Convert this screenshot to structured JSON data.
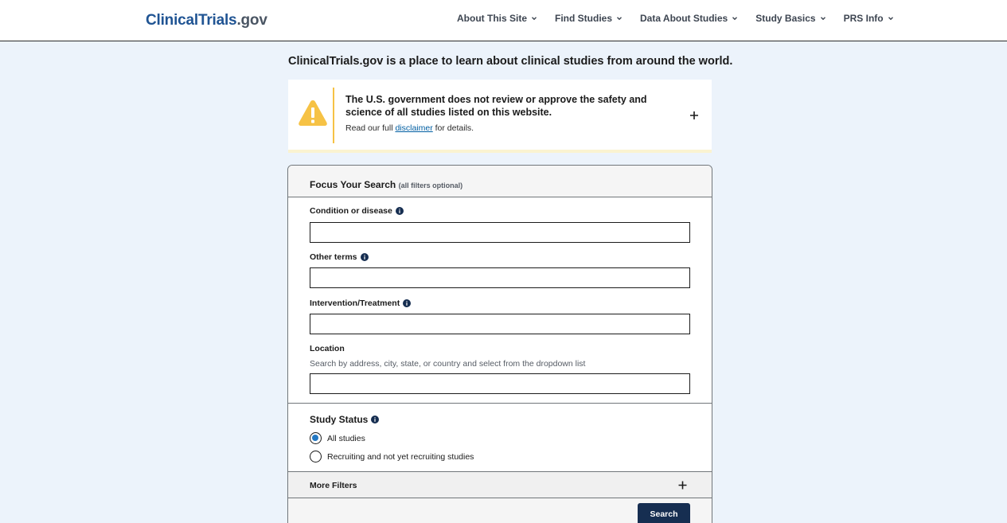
{
  "header": {
    "logo_part1": "Clinical",
    "logo_part2": "Trials",
    "logo_part3": ".gov",
    "nav": [
      {
        "label": "About This Site"
      },
      {
        "label": "Find Studies"
      },
      {
        "label": "Data About Studies"
      },
      {
        "label": "Study Basics"
      },
      {
        "label": "PRS Info"
      }
    ]
  },
  "intro": "ClinicalTrials.gov is a place to learn about clinical studies from around the world.",
  "alert": {
    "heading": "The U.S. government does not review or approve the safety and science of all studies listed on this website.",
    "sub_prefix": "Read our full ",
    "sub_link": "disclaimer",
    "sub_suffix": " for details."
  },
  "search": {
    "title": "Focus Your Search",
    "title_note": "(all filters optional)",
    "condition_label": "Condition or disease",
    "condition_value": "",
    "other_label": "Other terms",
    "other_value": "",
    "intervention_label": "Intervention/Treatment",
    "intervention_value": "",
    "location_label": "Location",
    "location_hint": "Search by address, city, state, or country and select from the dropdown list",
    "location_value": "",
    "status_label": "Study Status",
    "status_options": [
      {
        "label": "All studies",
        "selected": true
      },
      {
        "label": "Recruiting and not yet recruiting studies",
        "selected": false
      }
    ],
    "more_filters": "More Filters",
    "search_button": "Search"
  },
  "colors": {
    "navy": "#162e51",
    "link": "#005ea2",
    "warning": "#f6c245",
    "background": "#ecf3fb",
    "radio_selected": "#2378c3"
  }
}
